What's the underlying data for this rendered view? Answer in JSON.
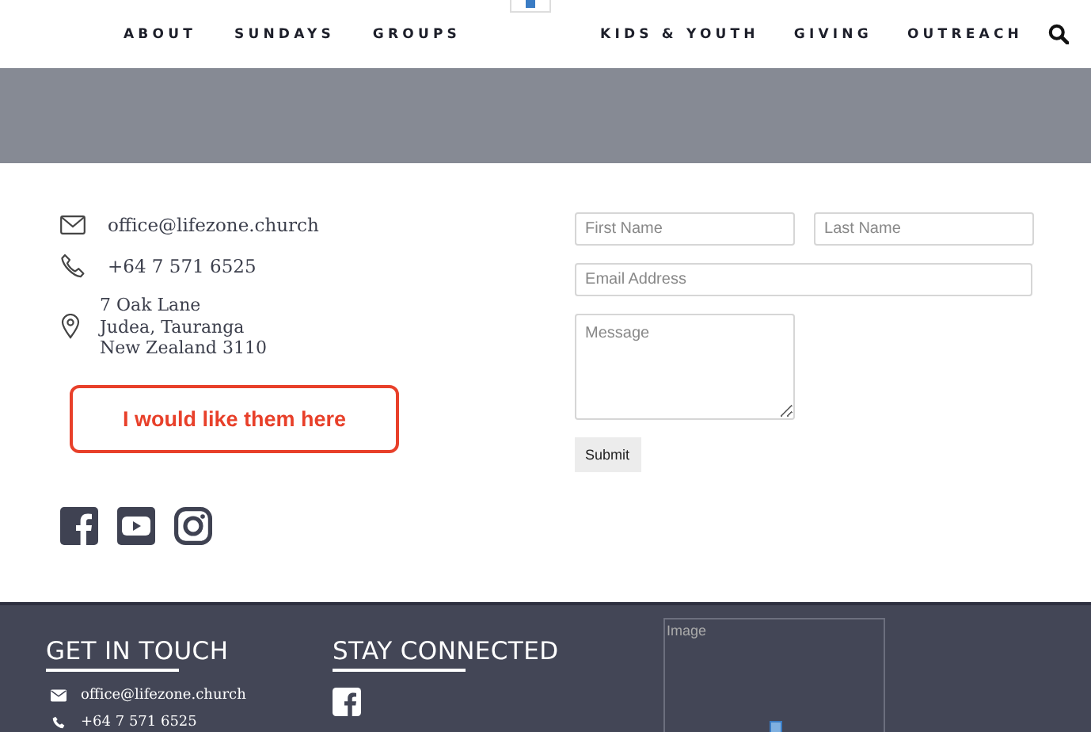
{
  "nav": {
    "left_links": [
      "ABOUT",
      "SUNDAYS",
      "GROUPS"
    ],
    "right_links": [
      "KIDS & YOUTH",
      "GIVING",
      "OUTREACH"
    ]
  },
  "contact": {
    "email": "office@lifezone.church",
    "phone": "+64 7 571 6525",
    "address": [
      "7 Oak Lane",
      "Judea, Tauranga",
      "New Zealand 3110"
    ]
  },
  "annotation": {
    "text": "I would like them here"
  },
  "form": {
    "first_name": {
      "placeholder": "First Name"
    },
    "last_name": {
      "placeholder": "Last Name"
    },
    "email": {
      "placeholder": "Email Address"
    },
    "message": {
      "placeholder": "Message"
    },
    "submit": "Submit"
  },
  "footer": {
    "get_in_touch": {
      "title": "GET IN TOUCH",
      "email": "office@lifezone.church",
      "phone": "+64 7 571 6525"
    },
    "stay_connected": {
      "title": "STAY CONNECTED"
    },
    "image": {
      "alt": "Image"
    }
  }
}
